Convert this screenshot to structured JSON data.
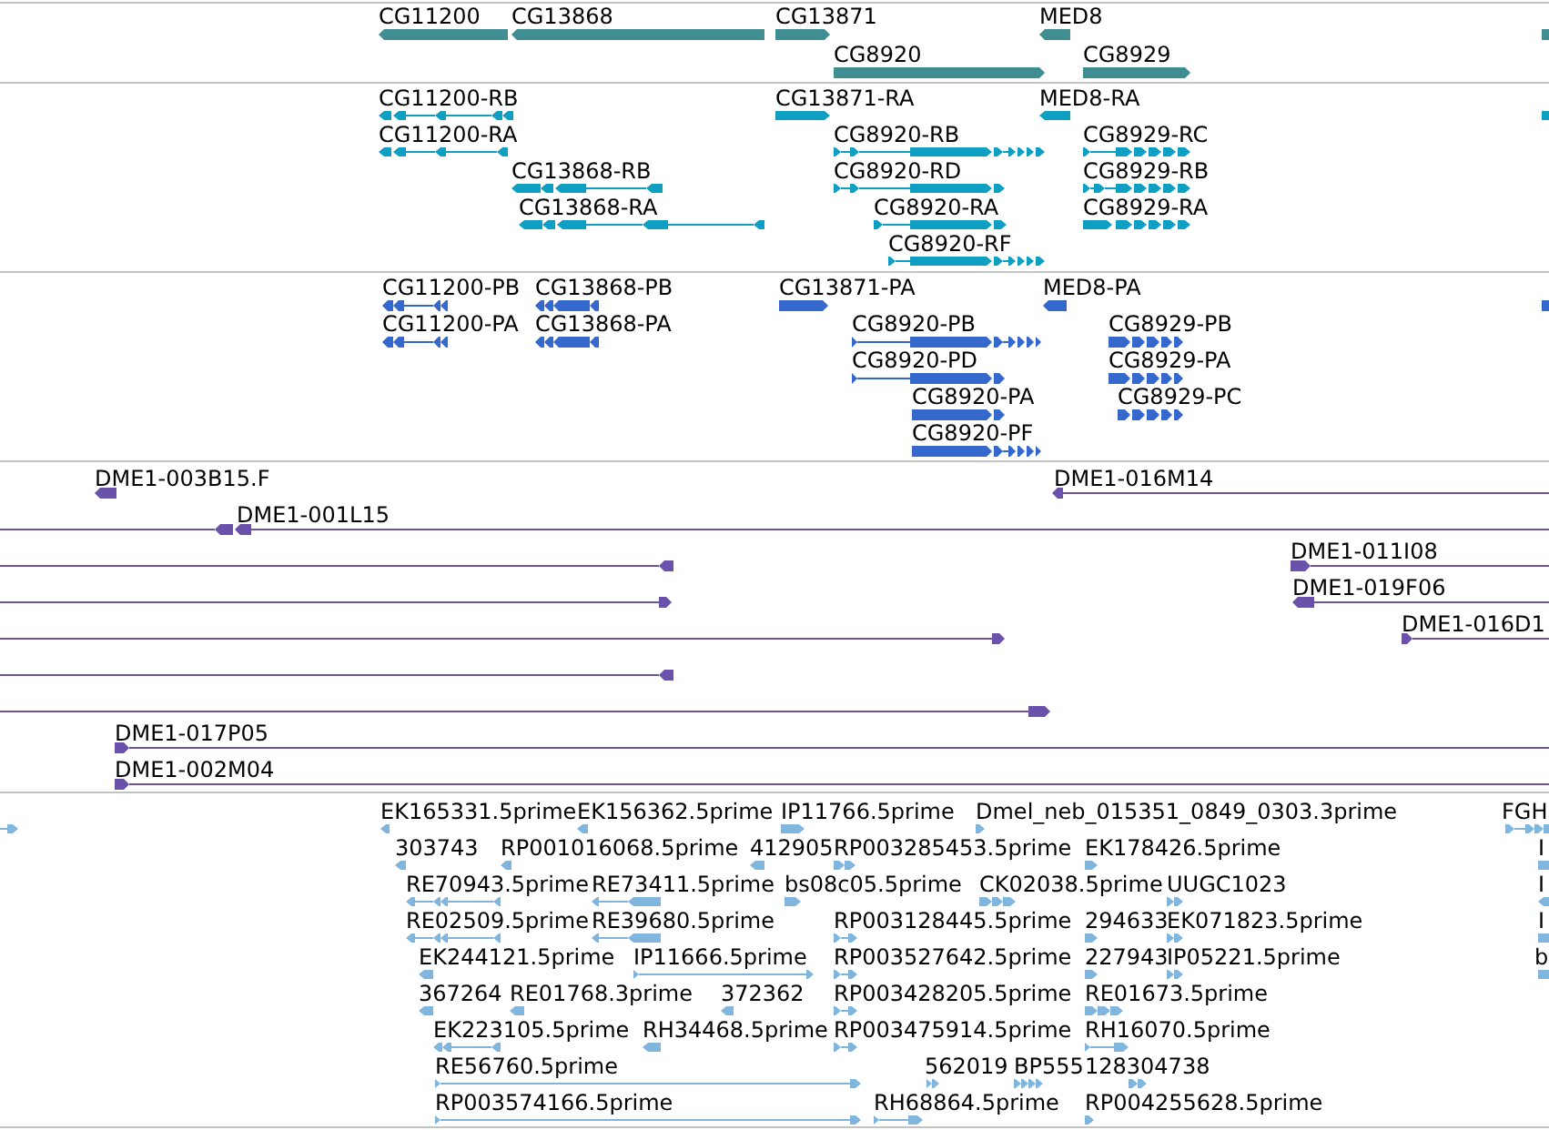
{
  "tracks": [
    {
      "features": [
        {
          "label": "CG11200",
          "points_left": true
        },
        {
          "label": "CG13868",
          "points_left": true
        },
        {
          "label": "CG13871",
          "points_left": false
        },
        {
          "label": "MED8",
          "points_left": true
        },
        {
          "label": "CG8920",
          "points_left": false
        },
        {
          "label": "CG8929",
          "points_left": false
        },
        {
          "points_left": false
        }
      ]
    },
    {
      "features": [
        {
          "label": "CG11200-RB",
          "points_left": true
        },
        {
          "label": "CG11200-RA",
          "points_left": true
        },
        {
          "label": "CG13868-RB",
          "points_left": true
        },
        {
          "label": "CG13868-RA",
          "points_left": true
        },
        {
          "label": "CG13871-RA",
          "points_left": false
        },
        {
          "label": "MED8-RA",
          "points_left": true
        },
        {
          "label": "CG8920-RB",
          "points_left": false
        },
        {
          "label": "CG8920-RD",
          "points_left": false
        },
        {
          "label": "CG8920-RA",
          "points_left": false
        },
        {
          "label": "CG8920-RF",
          "points_left": false
        },
        {
          "label": "CG8929-RC",
          "points_left": false
        },
        {
          "label": "CG8929-RB",
          "points_left": false
        },
        {
          "label": "CG8929-RA",
          "points_left": false
        },
        {
          "points_left": false
        }
      ]
    },
    {
      "features": [
        {
          "label": "CG11200-PB",
          "points_left": true
        },
        {
          "label": "CG11200-PA",
          "points_left": true
        },
        {
          "label": "CG13868-PB",
          "points_left": true
        },
        {
          "label": "CG13868-PA",
          "points_left": true
        },
        {
          "label": "CG13871-PA",
          "points_left": false
        },
        {
          "label": "MED8-PA",
          "points_left": true
        },
        {
          "label": "CG8920-PB",
          "points_left": false
        },
        {
          "label": "CG8920-PD",
          "points_left": false
        },
        {
          "label": "CG8920-PA",
          "points_left": false
        },
        {
          "label": "CG8920-PF",
          "points_left": false
        },
        {
          "label": "CG8929-PB",
          "points_left": false
        },
        {
          "label": "CG8929-PA",
          "points_left": false
        },
        {
          "label": "CG8929-PC",
          "points_left": false
        },
        {
          "points_left": false
        }
      ]
    },
    {
      "features": [
        {
          "label": "DME1-003B15.F",
          "points_left": true
        },
        {
          "label": "DME1-016M14",
          "points_left": true
        },
        {
          "label": "DME1-001L15",
          "points_left": true
        },
        {
          "points_left": true
        },
        {
          "label": "DME1-011I08",
          "points_left": false
        },
        {
          "points_left": false
        },
        {
          "label": "DME1-019F06",
          "points_left": true
        },
        {
          "points_left": false
        },
        {
          "label": "DME1-016D1",
          "points_left": false
        },
        {
          "points_left": true
        },
        {
          "points_left": false
        },
        {
          "label": "DME1-017P05",
          "points_left": false
        },
        {
          "label": "DME1-002M04",
          "points_left": false
        }
      ]
    },
    {
      "features": [
        {
          "points_left": false
        },
        {
          "label": "EK165331.5prime",
          "points_left": true
        },
        {
          "label": "EK156362.5prime",
          "points_left": true
        },
        {
          "label": "IP11766.5prime",
          "points_left": false
        },
        {
          "label": "Dmel_neb_015351_0849_0303.3prime",
          "points_left": false
        },
        {
          "label": "FGH",
          "points_left": false
        },
        {
          "label": "303743",
          "points_left": true
        },
        {
          "label": "RP001016068.5prime",
          "points_left": true
        },
        {
          "label": "412905",
          "points_left": true
        },
        {
          "label": "RP003285453.5prime",
          "points_left": false
        },
        {
          "label": "EK178426.5prime",
          "points_left": false
        },
        {
          "label": "I",
          "points_left": false
        },
        {
          "label": "RE70943.5prime",
          "points_left": true
        },
        {
          "label": "RE73411.5prime",
          "points_left": true
        },
        {
          "label": "bs08c05.5prime",
          "points_left": false
        },
        {
          "label": "CK02038.5prime",
          "points_left": false
        },
        {
          "label": "UUGC1023",
          "points_left": false
        },
        {
          "label": "I",
          "points_left": true
        },
        {
          "label": "RE02509.5prime",
          "points_left": true
        },
        {
          "label": "RE39680.5prime",
          "points_left": true
        },
        {
          "label": "RP003128445.5prime",
          "points_left": false
        },
        {
          "label": "294633",
          "points_left": false
        },
        {
          "label": "EK071823.5prime",
          "points_left": false
        },
        {
          "label": "I",
          "points_left": false
        },
        {
          "label": "EK244121.5prime",
          "points_left": true
        },
        {
          "label": "IP11666.5prime",
          "points_left": false
        },
        {
          "label": "RP003527642.5prime",
          "points_left": false
        },
        {
          "label": "227943",
          "points_left": false
        },
        {
          "label": "IP05221.5prime",
          "points_left": false
        },
        {
          "label": "b",
          "points_left": false
        },
        {
          "label": "367264",
          "points_left": true
        },
        {
          "label": "RE01768.3prime",
          "points_left": true
        },
        {
          "label": "372362",
          "points_left": true
        },
        {
          "label": "RP003428205.5prime",
          "points_left": false
        },
        {
          "label": "RE01673.5prime",
          "points_left": false
        },
        {
          "label": "EK223105.5prime",
          "points_left": true
        },
        {
          "label": "RH34468.5prime",
          "points_left": true
        },
        {
          "label": "RP003475914.5prime",
          "points_left": false
        },
        {
          "label": "RH16070.5prime",
          "points_left": false
        },
        {
          "label": "RE56760.5prime",
          "points_left": false
        },
        {
          "label": "562019",
          "points_left": false
        },
        {
          "label": "BP555",
          "points_left": false
        },
        {
          "label": "128304738",
          "points_left": false
        },
        {
          "label": "RP003574166.5prime",
          "points_left": false
        },
        {
          "label": "RH68864.5prime",
          "points_left": false
        },
        {
          "label": "RP004255628.5prime",
          "points_left": false
        }
      ]
    }
  ]
}
